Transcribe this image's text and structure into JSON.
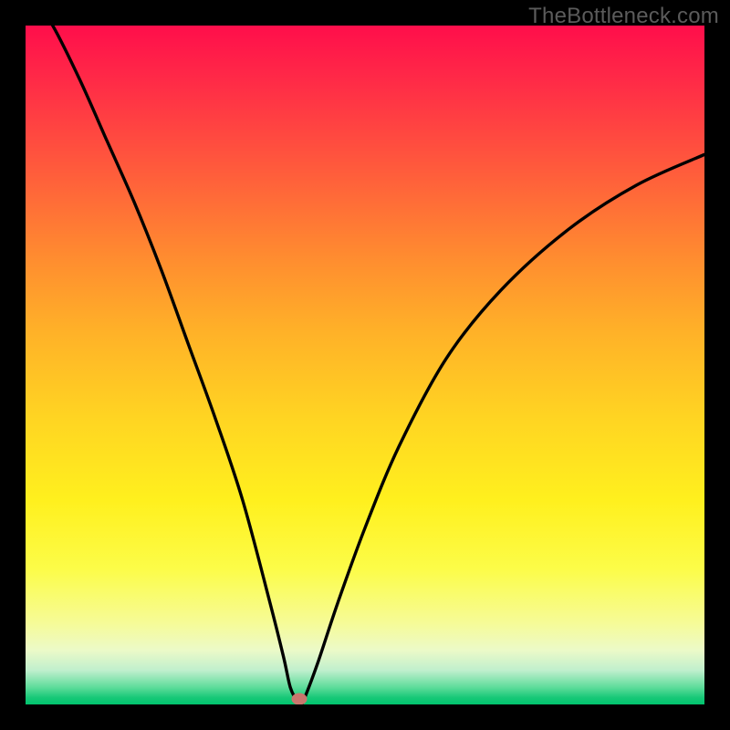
{
  "watermark": "TheBottleneck.com",
  "chart_data": {
    "type": "line",
    "title": "",
    "xlabel": "",
    "ylabel": "",
    "xlim": [
      0,
      100
    ],
    "ylim": [
      0,
      100
    ],
    "grid": false,
    "legend": false,
    "background_gradient": {
      "top": "#ff0e4b",
      "mid": "#ffe81e",
      "bottom": "#00c46e"
    },
    "series": [
      {
        "name": "bottleneck-curve",
        "color": "#000000",
        "x": [
          0,
          4,
          8,
          12,
          16,
          20,
          24,
          28,
          32,
          36,
          38,
          39,
          40,
          40.5,
          41,
          43,
          46,
          50,
          55,
          62,
          70,
          80,
          90,
          100
        ],
        "y": [
          106,
          100,
          92,
          83,
          74,
          64,
          53,
          42,
          30,
          15,
          7,
          2.5,
          0.5,
          0,
          0.7,
          6,
          15,
          26,
          38,
          51,
          61,
          70,
          76.5,
          81
        ]
      }
    ],
    "marker": {
      "x": 40.3,
      "y": 0.8,
      "color": "#c9766d"
    }
  }
}
